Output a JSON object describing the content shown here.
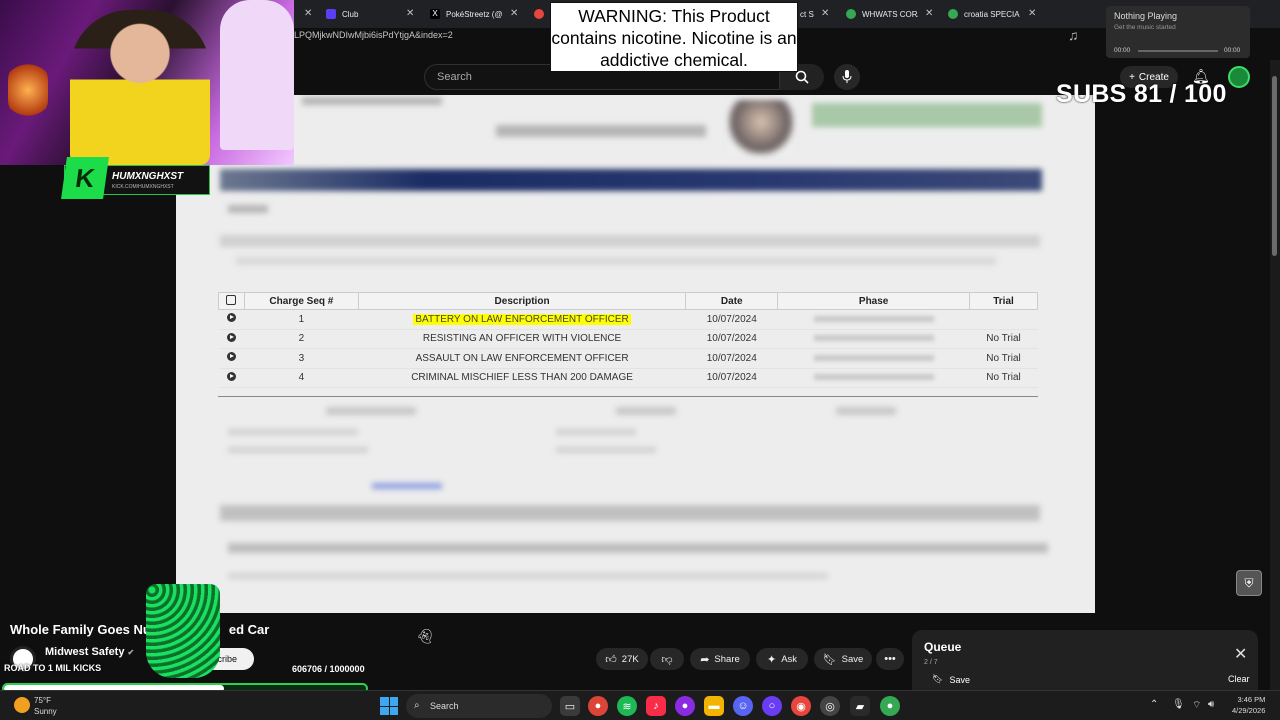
{
  "browser": {
    "tabs": [
      {
        "label": "Club",
        "color": "#5b3df5"
      },
      {
        "label": "PokéStreetz (@",
        "color": "#000000"
      },
      {
        "label": "",
        "color": "#e8453c"
      },
      {
        "label": "ct S",
        "color": "#1a73e8"
      },
      {
        "label": "WHWATS COR/",
        "color": "#34a853"
      },
      {
        "label": "croatia SPECIAL",
        "color": "#34a853"
      }
    ],
    "address_fragment": "LPQMjkwNDIwMjbi6isPdYtjgA&index=2"
  },
  "warning": {
    "text": "WARNING: This Product contains nicotine. Nicotine is an addictive chemical."
  },
  "overlay": {
    "channel_name": "HUMXNGHXST",
    "channel_url": "KICK.COM/HUMXNGHXST",
    "subs_text": "SUBS 81 / 100",
    "road_text": "ROAD TO 1 MIL KICKS",
    "kicks_count": "606706 / 1000000",
    "kicks_progress": 0.6067
  },
  "now_playing": {
    "title": "Nothing Playing",
    "subtitle": "Get the music started",
    "time_start": "00:00",
    "time_end": "00:00"
  },
  "youtube": {
    "search_placeholder": "Search",
    "create_label": "Create",
    "video_title": "Whole Family Goes Nu",
    "video_title_end": "ed Car",
    "channel_name": "Midwest Safety",
    "subscribe_label": "scribe",
    "likes": "27K",
    "share_label": "Share",
    "ask_label": "Ask",
    "save_label": "Save",
    "queue": {
      "title": "Queue",
      "count": "2 / 7",
      "save_label": "Save",
      "clear_label": "Clear"
    }
  },
  "charges_table": {
    "headers": [
      "Charge Seq #",
      "Description",
      "Date",
      "Phase",
      "Trial"
    ],
    "rows": [
      {
        "seq": "1",
        "description": "BATTERY ON LAW ENFORCEMENT OFFICER",
        "date": "10/07/2024",
        "trial": ""
      },
      {
        "seq": "2",
        "description": "RESISTING AN OFFICER WITH VIOLENCE",
        "date": "10/07/2024",
        "trial": "No Trial"
      },
      {
        "seq": "3",
        "description": "ASSAULT ON LAW ENFORCEMENT OFFICER",
        "date": "10/07/2024",
        "trial": "No Trial"
      },
      {
        "seq": "4",
        "description": "CRIMINAL MISCHIEF LESS THAN 200 DAMAGE",
        "date": "10/07/2024",
        "trial": "No Trial"
      }
    ],
    "highlight_color": "#ffff00"
  },
  "taskbar": {
    "temperature": "75°F",
    "condition": "Sunny",
    "search_label": "Search",
    "time": "3:46 PM",
    "date": "4/29/2026"
  },
  "icons": [
    "search-icon",
    "mic-icon",
    "bell-icon",
    "like-icon",
    "dislike-icon",
    "share-icon",
    "ask-icon",
    "save-icon",
    "more-icon",
    "close-icon",
    "windows-icon"
  ]
}
